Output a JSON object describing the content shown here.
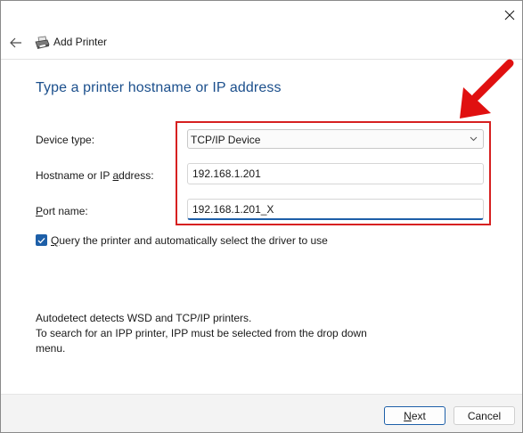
{
  "window": {
    "title": "Add Printer"
  },
  "heading": "Type a printer hostname or IP address",
  "form": {
    "device_type_label_prefix": "Device type:",
    "device_type_value": "TCP/IP Device",
    "hostname_label_pre": "Hostname or IP ",
    "hostname_label_ul": "a",
    "hostname_label_post": "ddress:",
    "hostname_value": "192.168.1.201",
    "port_label_ul": "P",
    "port_label_post": "ort name:",
    "port_value": "192.168.1.201_X"
  },
  "query_checkbox": {
    "checked": true,
    "label_ul": "Q",
    "label_post": "uery the printer and automatically select the driver to use"
  },
  "info": {
    "line1": "Autodetect detects WSD and TCP/IP printers.",
    "line2": "To search for an IPP printer, IPP must be selected from the drop down",
    "line3": "menu."
  },
  "buttons": {
    "next_ul": "N",
    "next_post": "ext",
    "cancel": "Cancel"
  },
  "colors": {
    "accent": "#1d5fa8",
    "heading": "#1b4f8c",
    "highlight": "#d62020"
  },
  "icons": {
    "close": "close-icon",
    "back": "back-arrow-icon",
    "printer": "printer-icon",
    "dropdown": "chevron-down-icon",
    "annotation": "red-arrow-icon"
  }
}
